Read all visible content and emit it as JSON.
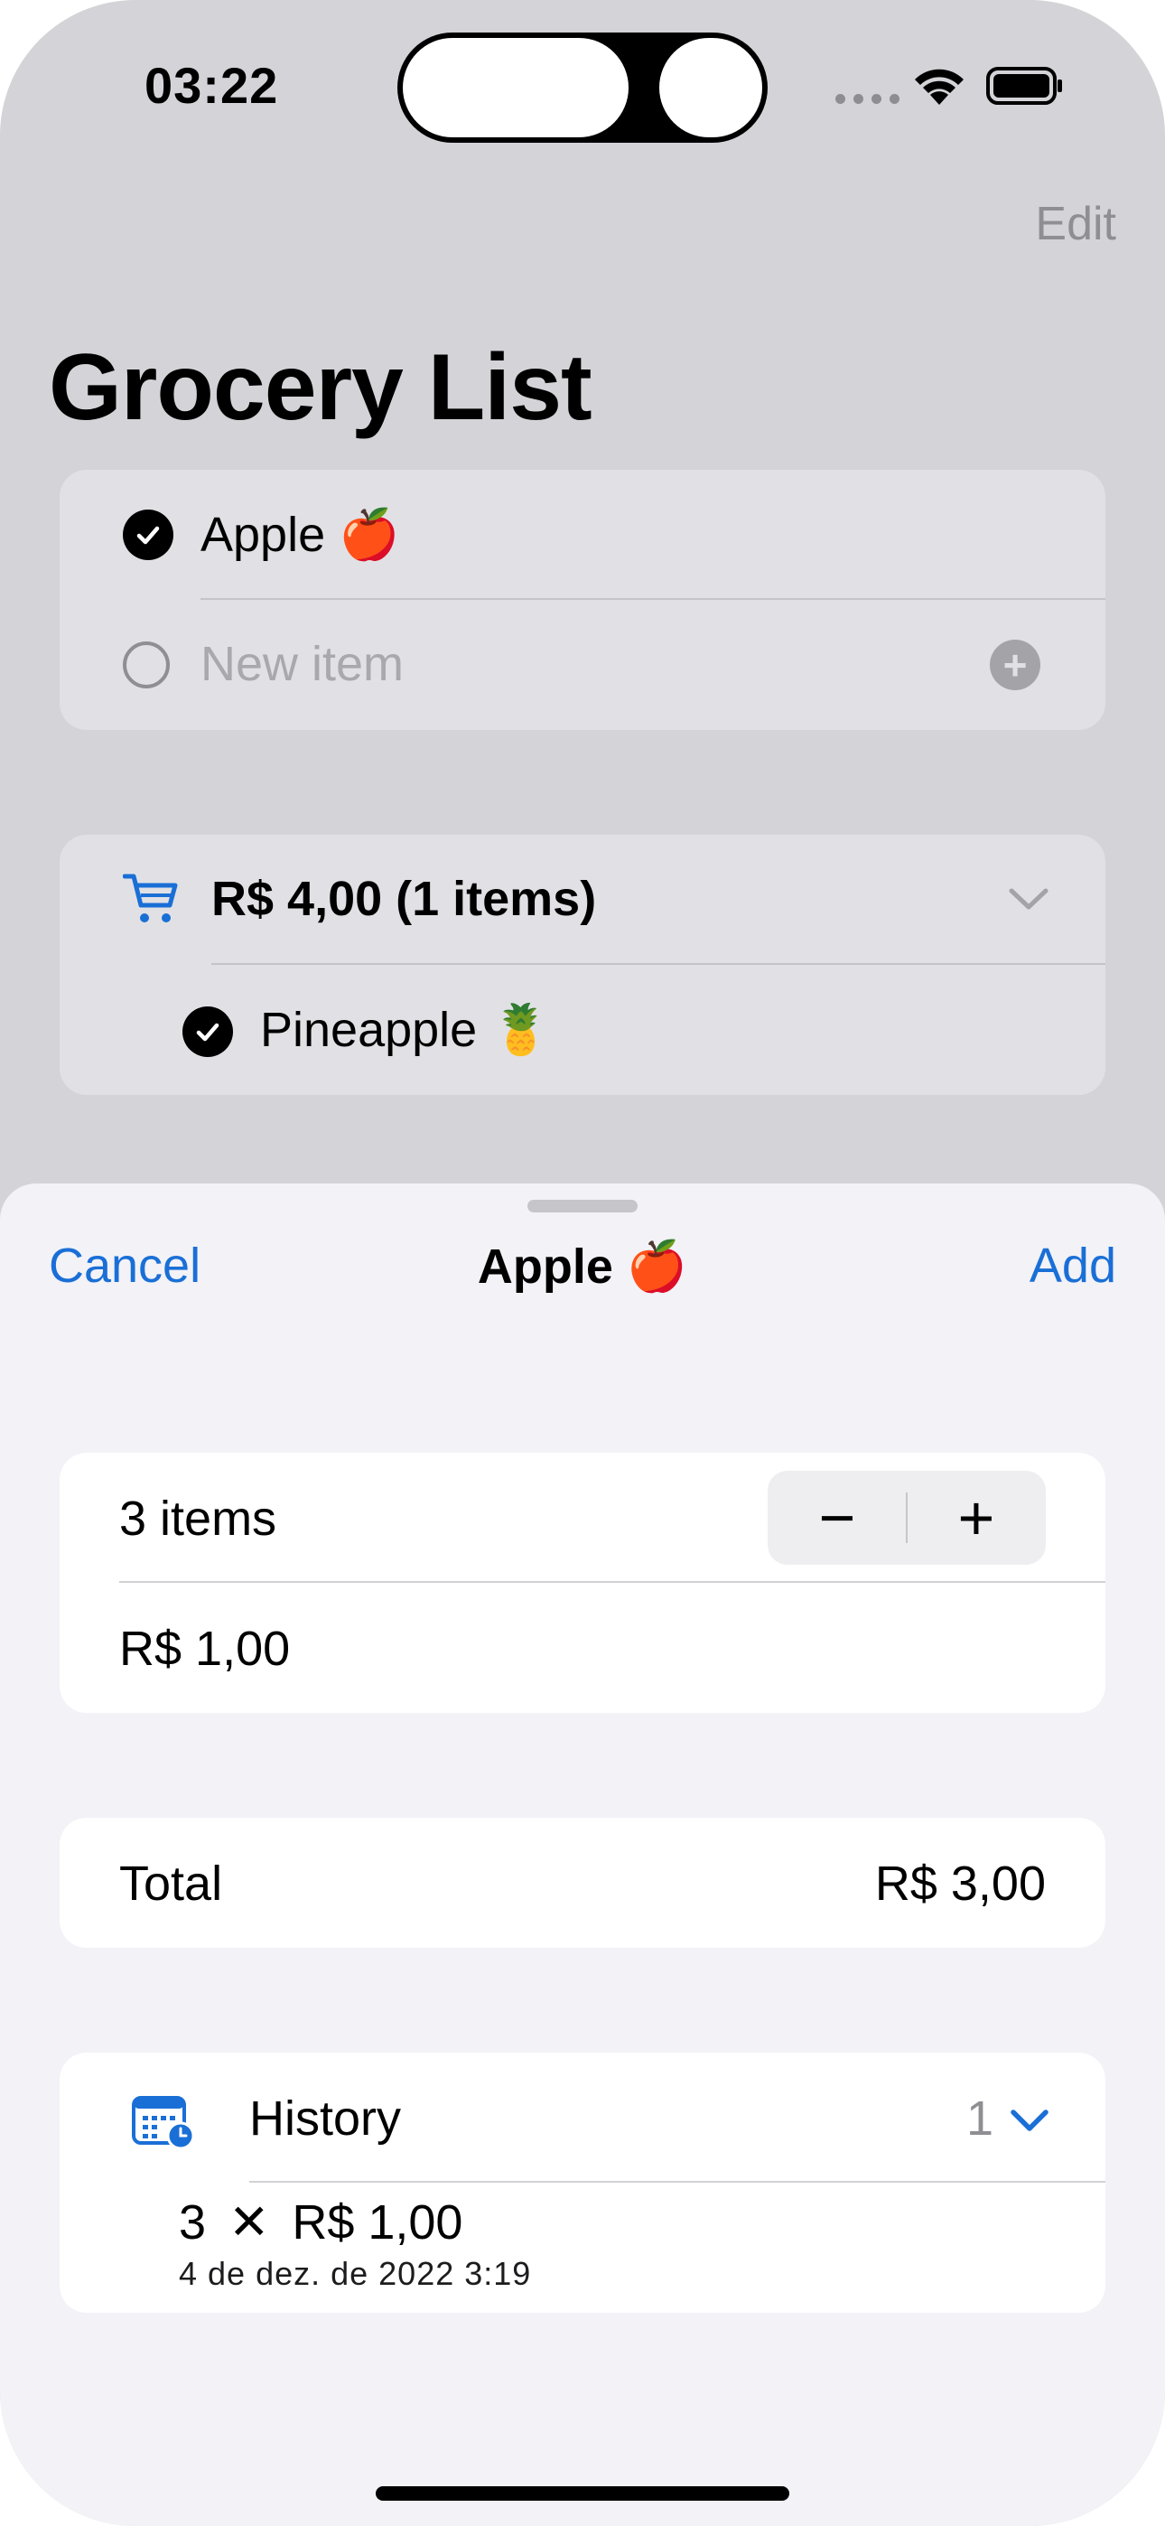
{
  "status_bar": {
    "time": "03:22"
  },
  "header": {
    "edit_label": "Edit",
    "title": "Grocery List"
  },
  "list": {
    "items": [
      {
        "label": "Apple",
        "emoji": "🍎",
        "checked": true
      }
    ],
    "new_item_placeholder": "New item"
  },
  "cart": {
    "summary": "R$ 4,00 (1 items)",
    "items": [
      {
        "label": "Pineapple",
        "emoji": "🍍",
        "checked": true
      }
    ]
  },
  "sheet": {
    "cancel_label": "Cancel",
    "title": "Apple",
    "title_emoji": "🍎",
    "add_label": "Add",
    "quantity_label": "3 items",
    "stepper_minus": "−",
    "stepper_plus": "+",
    "unit_price": "R$ 1,00",
    "total_label": "Total",
    "total_value": "R$ 3,00",
    "history": {
      "label": "History",
      "count": "1",
      "entries": [
        {
          "quantity": "3",
          "times": "✕",
          "price": "R$ 1,00",
          "date": "4 de dez. de 2022 3:19"
        }
      ]
    }
  },
  "colors": {
    "accent": "#1a6fd6",
    "background": "#d3d3d8",
    "sheet": "#f2f2f7"
  }
}
